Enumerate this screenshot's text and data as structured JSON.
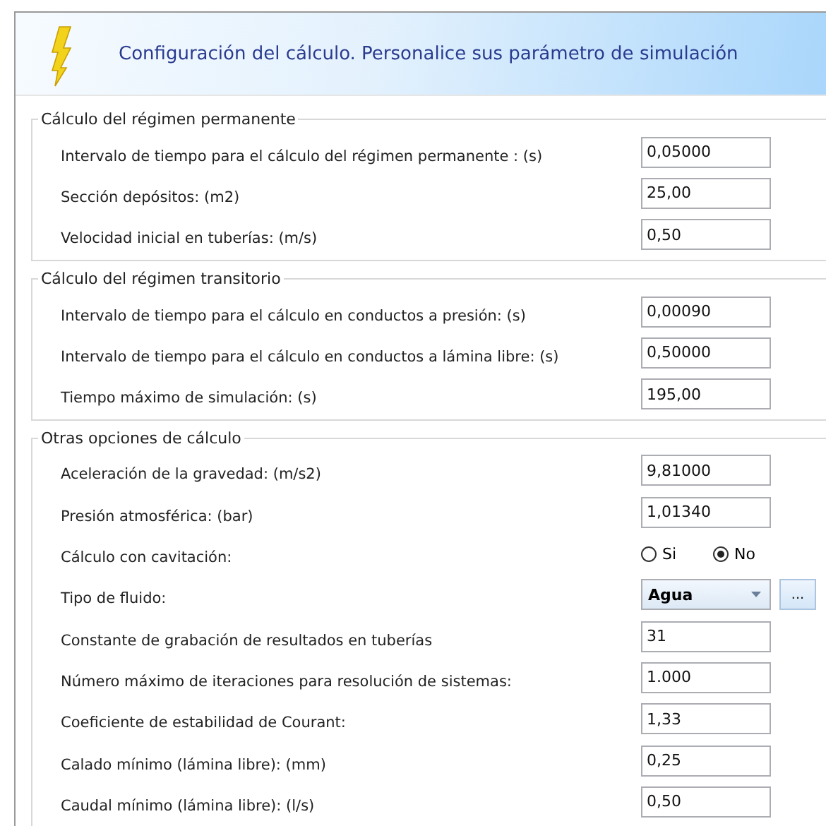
{
  "header": {
    "title": "Configuración del cálculo. Personalice sus parámetro de simulación"
  },
  "groups": [
    {
      "title": "Cálculo del régimen permanente",
      "rows": [
        {
          "kind": "text",
          "label": "Intervalo de tiempo para el cálculo del régimen permanente : (s)",
          "value": "0,05000"
        },
        {
          "kind": "text",
          "label": "Sección depósitos: (m2)",
          "value": "25,00"
        },
        {
          "kind": "text",
          "label": "Velocidad inicial en tuberías: (m/s)",
          "value": "0,50"
        }
      ]
    },
    {
      "title": "Cálculo del régimen transitorio",
      "rows": [
        {
          "kind": "text",
          "label": "Intervalo de tiempo para el cálculo en conductos a presión: (s)",
          "value": "0,00090"
        },
        {
          "kind": "text",
          "label": "Intervalo de tiempo para el cálculo en conductos a lámina libre: (s)",
          "value": "0,50000"
        },
        {
          "kind": "text",
          "label": "Tiempo máximo de simulación: (s)",
          "value": "195,00"
        }
      ]
    },
    {
      "title": "Otras opciones de cálculo",
      "rows": [
        {
          "kind": "text",
          "label": "Aceleración de la gravedad: (m/s2)",
          "value": "9,81000"
        },
        {
          "kind": "text",
          "label": "Presión atmosférica: (bar)",
          "value": "1,01340"
        },
        {
          "kind": "radio",
          "label": "Cálculo con cavitación:",
          "options": [
            {
              "label": "Si",
              "selected": false
            },
            {
              "label": "No",
              "selected": true
            }
          ]
        },
        {
          "kind": "select",
          "label": "Tipo de fluido:",
          "value": "Agua",
          "button": "..."
        },
        {
          "kind": "text",
          "label": "Constante de grabación de resultados en tuberías",
          "value": "31"
        },
        {
          "kind": "text",
          "label": "Número máximo de iteraciones para resolución de sistemas:",
          "value": "1.000"
        },
        {
          "kind": "text",
          "label": "Coeficiente de estabilidad de Courant:",
          "value": "1,33"
        },
        {
          "kind": "text",
          "label": "Calado mínimo (lámina libre): (mm)",
          "value": "0,25"
        },
        {
          "kind": "text",
          "label": "Caudal mínimo (lámina libre): (l/s)",
          "value": "0,50"
        }
      ]
    }
  ]
}
